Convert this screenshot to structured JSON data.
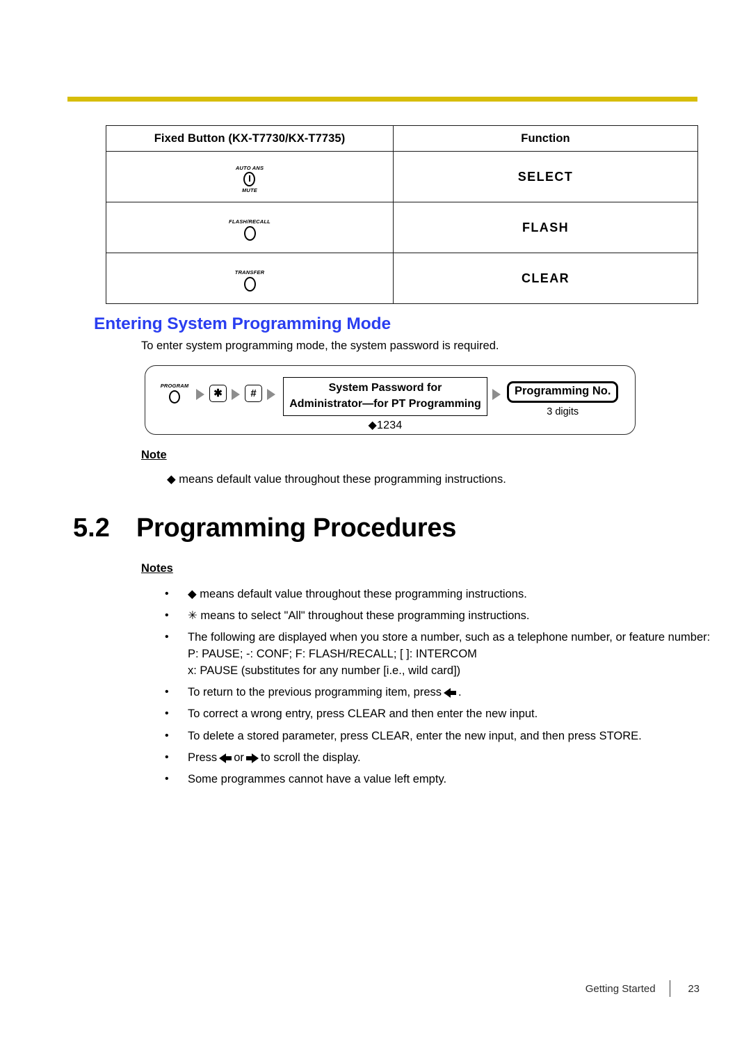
{
  "theme": {
    "rule_color": "#d7bd09",
    "heading_blue": "#2a3ef0",
    "arrow_gray": "#8d8d8d"
  },
  "button_table": {
    "headers": [
      "Fixed Button (KX-T7730/KX-T7735)",
      "Function"
    ],
    "rows": [
      {
        "key_top": "AUTO ANS",
        "key_bottom": "MUTE",
        "icon": "oval-power-key-icon",
        "function": "SELECT"
      },
      {
        "key_top": "FLASH/RECALL",
        "key_bottom": "",
        "icon": "oval-key-icon",
        "function": "FLASH"
      },
      {
        "key_top": "TRANSFER",
        "key_bottom": "",
        "icon": "oval-key-icon",
        "function": "CLEAR"
      }
    ]
  },
  "entering_mode": {
    "heading": "Entering System Programming Mode",
    "intro": "To enter system programming mode, the system password is required.",
    "flow": {
      "program_key_label": "PROGRAM",
      "key_star": "✱",
      "key_hash": "#",
      "password_line1": "System Password for",
      "password_line2": "Administrator—for PT Programming",
      "password_default": "◆1234",
      "programming_no_label": "Programming No.",
      "programming_no_sub": "3 digits"
    }
  },
  "note": {
    "title": "Note",
    "text": "◆ means default value throughout these programming instructions."
  },
  "section": {
    "number": "5.2",
    "title": "Programming Procedures",
    "notes_title": "Notes",
    "notes": [
      {
        "text": "◆ means default value throughout these programming instructions."
      },
      {
        "text": "✳ means to select \"All\" throughout these programming instructions."
      },
      {
        "text": "The following are displayed when you store a number, such as a telephone number, or feature number:",
        "extra_lines": [
          "P: PAUSE; -: CONF; F: FLASH/RECALL; [ ]: INTERCOM",
          "x: PAUSE (substitutes for any number [i.e., wild card])"
        ]
      },
      {
        "text_before": "To return to the previous programming item, press",
        "arrow": "left",
        "text_after": "."
      },
      {
        "text": "To correct a wrong entry, press CLEAR and then enter the new input."
      },
      {
        "text": "To delete a stored parameter, press CLEAR, enter the new input, and then press STORE."
      },
      {
        "text_before": "Press",
        "arrow": "left",
        "text_middle": "or",
        "arrow2": "right",
        "text_after": "to scroll the display."
      },
      {
        "text": "Some programmes cannot have a value left empty."
      }
    ]
  },
  "footer": {
    "section_name": "Getting Started",
    "page_number": "23"
  }
}
